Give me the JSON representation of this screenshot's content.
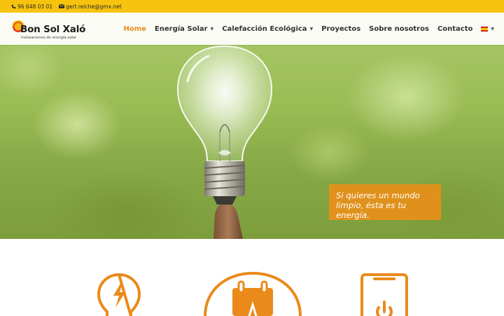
{
  "topbar": {
    "phone": "96 648 03 01",
    "email": "gert.reiche@gmx.net"
  },
  "header": {
    "logo_title": "Bon Sol Xaló",
    "logo_subtitle": "Instalaciones de energía solar"
  },
  "nav": {
    "items": [
      {
        "label": "Home",
        "active": true,
        "dropdown": false
      },
      {
        "label": "Energía Solar",
        "active": false,
        "dropdown": true
      },
      {
        "label": "Calefacción Ecológica",
        "active": false,
        "dropdown": true
      },
      {
        "label": "Proyectos",
        "active": false,
        "dropdown": false
      },
      {
        "label": "Sobre nosotros",
        "active": false,
        "dropdown": false
      },
      {
        "label": "Contacto",
        "active": false,
        "dropdown": false
      }
    ],
    "language_icon": "spain-flag-icon"
  },
  "hero": {
    "quote": "Si quieres un mundo limpio, ésta es tu energía."
  },
  "features": {
    "icons": [
      "lightbulb-bolt-icon",
      "calendar-icon",
      "smartphone-power-icon"
    ]
  },
  "colors": {
    "accent": "#e98a1f",
    "topbar": "#f7c30e",
    "text": "#333333"
  }
}
